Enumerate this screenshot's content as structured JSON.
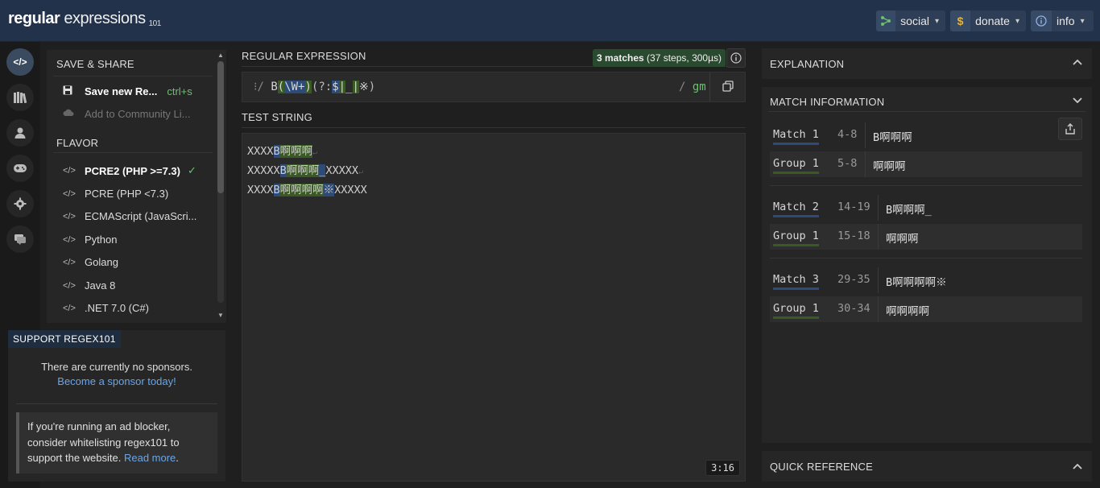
{
  "header": {
    "logo_bold": "regular",
    "logo_light": " expressions",
    "logo_sub": "101",
    "buttons": [
      {
        "label": "social",
        "icon": "share-icon"
      },
      {
        "label": "donate",
        "icon": "dollar-icon"
      },
      {
        "label": "info",
        "icon": "info-icon"
      }
    ]
  },
  "sidemenu": {
    "save_share_title": "SAVE & SHARE",
    "save_new_label": "Save new Re...",
    "save_shortcut": "ctrl+s",
    "add_community_label": "Add to Community Li...",
    "flavor_title": "FLAVOR",
    "flavors": [
      "PCRE2 (PHP >=7.3)",
      "PCRE (PHP <7.3)",
      "ECMAScript (JavaScri...",
      "Python",
      "Golang",
      "Java 8",
      ".NET 7.0 (C#)"
    ]
  },
  "support": {
    "tag": "SUPPORT REGEX101",
    "line1": "There are currently no sponsors.",
    "line2": "Become a sponsor today!",
    "ad_text1": "If you're running an ad blocker, consider whitelisting regex101 to support the website. ",
    "ad_link": "Read more",
    "ad_end": "."
  },
  "regex": {
    "section_label": "REGULAR EXPRESSION",
    "match_count": "3 matches",
    "match_detail": " (37 steps, 300µs)",
    "delimiter_open": "/",
    "parts": [
      "B",
      "(",
      "\\W+",
      ")",
      "(?:",
      "$",
      "|",
      "_",
      "|",
      "※",
      ")"
    ],
    "delimiter_close": "/",
    "flags": "gm"
  },
  "test": {
    "section_label": "TEST STRING",
    "line1": {
      "pre": "XXXX",
      "m1": "B",
      "m2": "啊啊啊",
      "post": ""
    },
    "line2": {
      "pre": "XXXXX",
      "m1": "B",
      "m2": "啊啊啊",
      "m3": "_",
      "post": "XXXXX"
    },
    "line3": {
      "pre": "XXXX",
      "m1": "B",
      "m2": "啊啊啊啊",
      "m3": "※",
      "post": "XXXXX"
    },
    "cursor": "3:16"
  },
  "explanation": {
    "title": "EXPLANATION"
  },
  "match_info": {
    "title": "MATCH INFORMATION",
    "matches": [
      {
        "label": "Match 1",
        "range": "4-8",
        "value": "B啊啊啊",
        "group_label": "Group 1",
        "group_range": "5-8",
        "group_value": "啊啊啊"
      },
      {
        "label": "Match 2",
        "range": "14-19",
        "value": "B啊啊啊_",
        "group_label": "Group 1",
        "group_range": "15-18",
        "group_value": "啊啊啊"
      },
      {
        "label": "Match 3",
        "range": "29-35",
        "value": "B啊啊啊啊※",
        "group_label": "Group 1",
        "group_range": "30-34",
        "group_value": "啊啊啊啊"
      }
    ]
  },
  "quick_ref": {
    "title": "QUICK REFERENCE"
  }
}
